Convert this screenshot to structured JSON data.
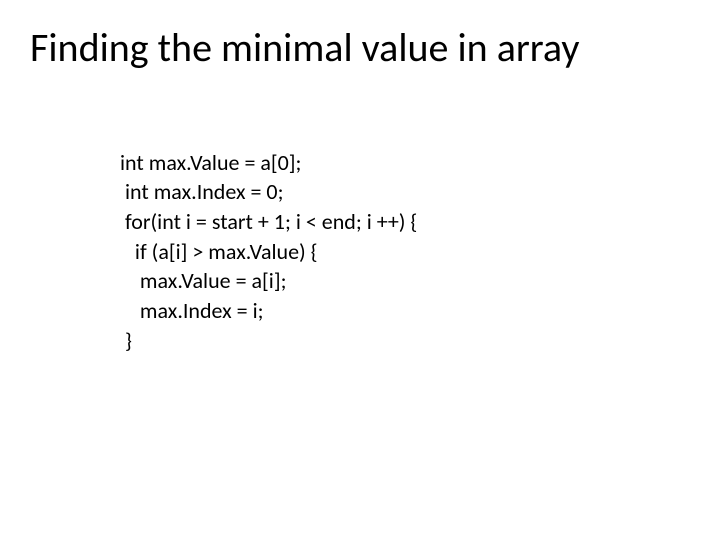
{
  "title": "Finding the minimal value in array",
  "code": {
    "l1": "int max.Value = a[0];",
    "l2": " int max.Index = 0;",
    "l3": " for(int i = start + 1; i < end; i ++) {",
    "l4": "   if (a[i] > max.Value) {",
    "l5": "    max.Value = a[i];",
    "l6": "    max.Index = i;",
    "l7": " }"
  }
}
